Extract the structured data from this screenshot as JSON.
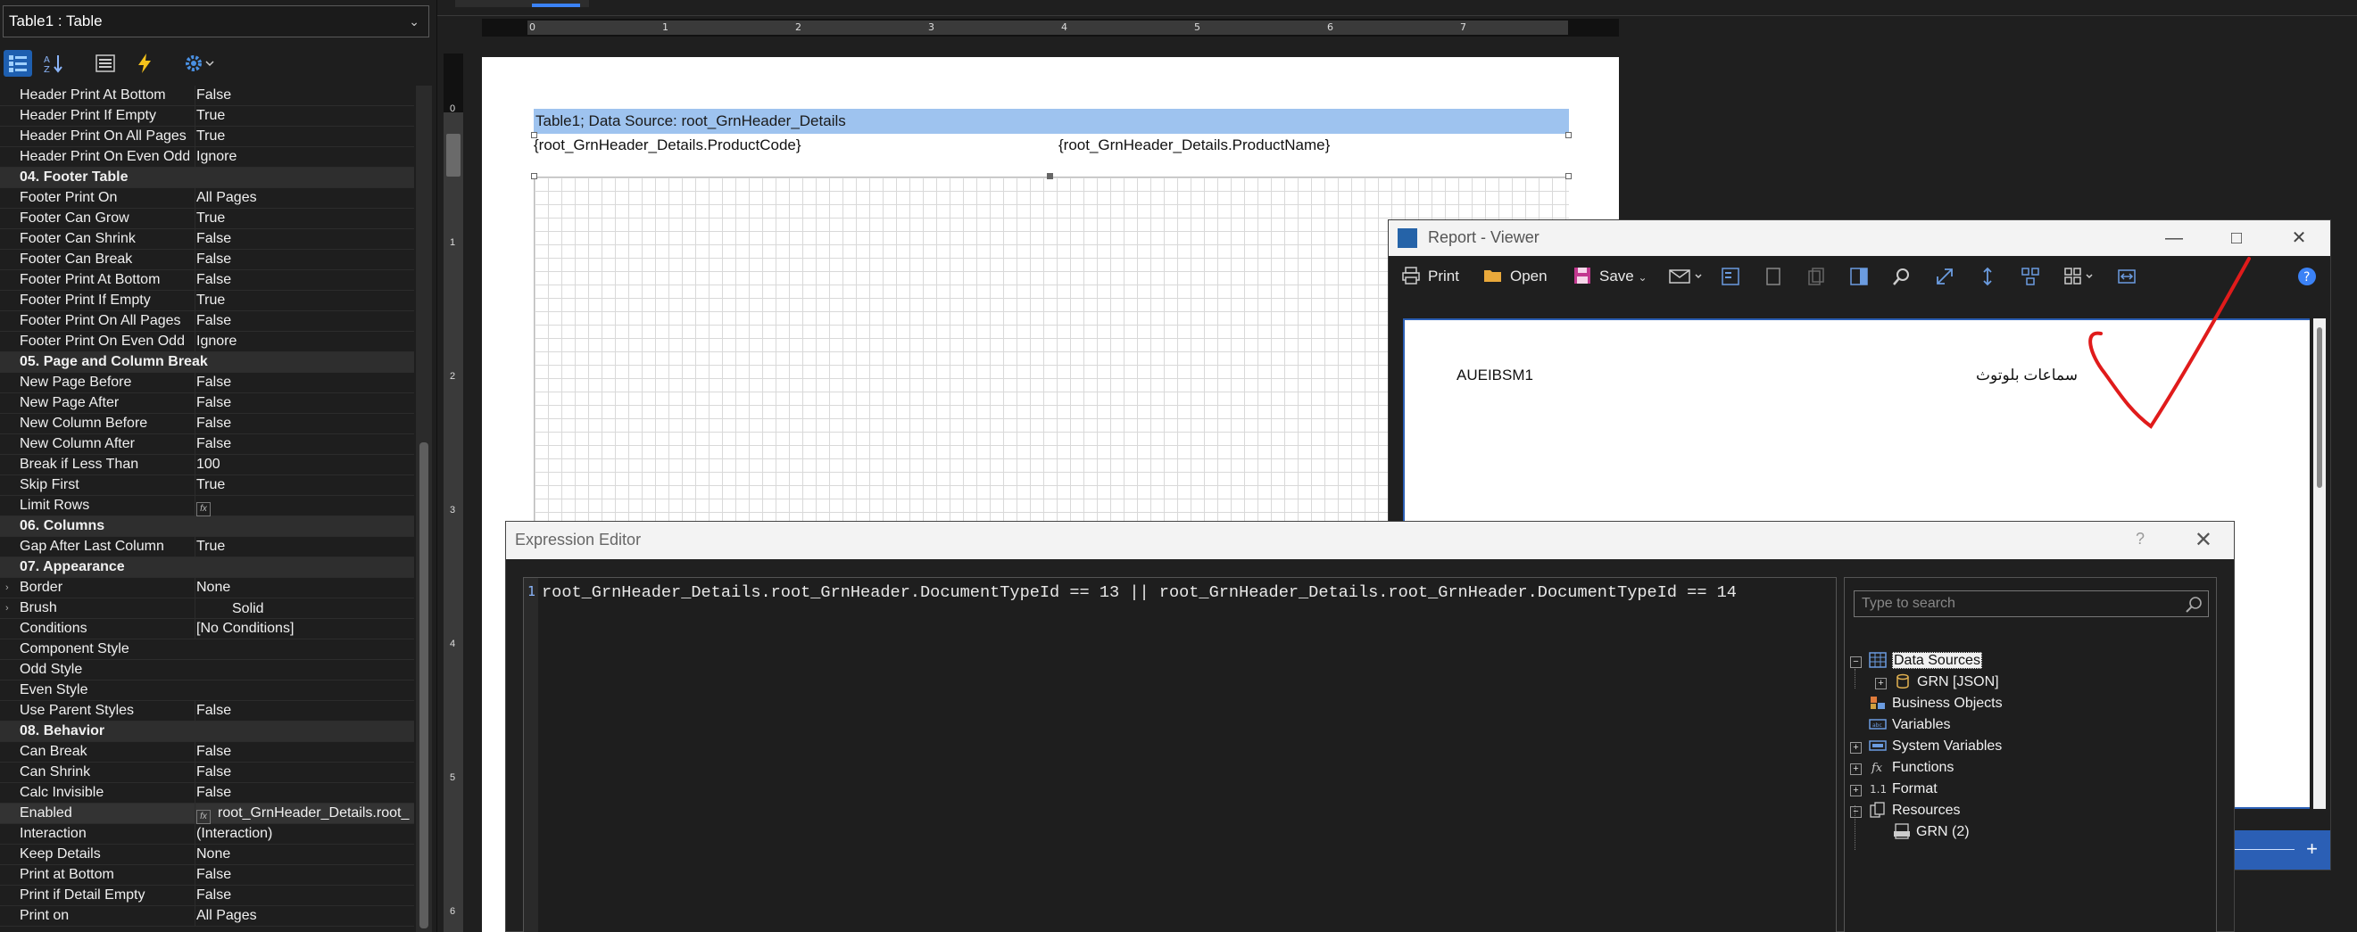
{
  "property_panel": {
    "object_selector": "Table1 : Table",
    "rows": [
      {
        "type": "prop",
        "name": "Header Print At Bottom",
        "value": "False"
      },
      {
        "type": "prop",
        "name": "Header Print If Empty",
        "value": "True"
      },
      {
        "type": "prop",
        "name": "Header Print On All Pages",
        "value": "True"
      },
      {
        "type": "prop",
        "name": "Header Print On Even Odd",
        "value": "Ignore"
      },
      {
        "type": "cat",
        "name": "04. Footer  Table"
      },
      {
        "type": "prop",
        "name": "Footer Print On",
        "value": "All Pages"
      },
      {
        "type": "prop",
        "name": "Footer Can Grow",
        "value": "True"
      },
      {
        "type": "prop",
        "name": "Footer Can Shrink",
        "value": "False"
      },
      {
        "type": "prop",
        "name": "Footer Can Break",
        "value": "False"
      },
      {
        "type": "prop",
        "name": "Footer Print At Bottom",
        "value": "False"
      },
      {
        "type": "prop",
        "name": "Footer Print If Empty",
        "value": "True"
      },
      {
        "type": "prop",
        "name": "Footer Print On All Pages",
        "value": "False"
      },
      {
        "type": "prop",
        "name": "Footer Print On Even Odd P",
        "value": "Ignore"
      },
      {
        "type": "cat",
        "name": "05. Page and  Column  Break"
      },
      {
        "type": "prop",
        "name": "New Page Before",
        "value": "False"
      },
      {
        "type": "prop",
        "name": "New Page After",
        "value": "False"
      },
      {
        "type": "prop",
        "name": "New Column Before",
        "value": "False"
      },
      {
        "type": "prop",
        "name": "New Column After",
        "value": "False"
      },
      {
        "type": "prop",
        "name": "Break if Less Than",
        "value": "100"
      },
      {
        "type": "prop",
        "name": "Skip First",
        "value": "True"
      },
      {
        "type": "fx",
        "name": "Limit Rows",
        "value": ""
      },
      {
        "type": "cat",
        "name": "06. Columns"
      },
      {
        "type": "prop",
        "name": "Gap After Last Column",
        "value": "True"
      },
      {
        "type": "cat",
        "name": "07. Appearance"
      },
      {
        "type": "prop",
        "name": "Border",
        "value": "None",
        "expandable": true
      },
      {
        "type": "brush",
        "name": "Brush",
        "value": "Solid",
        "expandable": true
      },
      {
        "type": "prop",
        "name": "Conditions",
        "value": "[No Conditions]"
      },
      {
        "type": "prop",
        "name": "Component Style",
        "value": ""
      },
      {
        "type": "prop",
        "name": "Odd Style",
        "value": ""
      },
      {
        "type": "prop",
        "name": "Even Style",
        "value": ""
      },
      {
        "type": "prop",
        "name": "Use Parent Styles",
        "value": "False"
      },
      {
        "type": "cat",
        "name": "08. Behavior"
      },
      {
        "type": "prop",
        "name": "Can Break",
        "value": "False"
      },
      {
        "type": "prop",
        "name": "Can Shrink",
        "value": "False"
      },
      {
        "type": "prop",
        "name": "Calc Invisible",
        "value": "False"
      },
      {
        "type": "fx",
        "name": "Enabled",
        "value": "root_GrnHeader_Details.root_",
        "selected": true
      },
      {
        "type": "prop",
        "name": "Interaction",
        "value": "(Interaction)"
      },
      {
        "type": "prop",
        "name": "Keep Details",
        "value": "None"
      },
      {
        "type": "prop",
        "name": "Print at Bottom",
        "value": "False"
      },
      {
        "type": "prop",
        "name": "Print if Detail Empty",
        "value": "False"
      },
      {
        "type": "prop",
        "name": "Print on",
        "value": "All Pages"
      }
    ]
  },
  "designer": {
    "ruler_h": [
      "0",
      "1",
      "2",
      "3",
      "4",
      "5",
      "6",
      "7"
    ],
    "ruler_v": [
      "0",
      "1",
      "2",
      "3",
      "4",
      "5",
      "6"
    ],
    "header_band": "Table1; Data Source: root_GrnHeader_Details",
    "cell_product_code": "{root_GrnHeader_Details.ProductCode}",
    "cell_product_name": "{root_GrnHeader_Details.ProductName}"
  },
  "viewer": {
    "title": "Report - Viewer",
    "toolbar": {
      "print": "Print",
      "open": "Open",
      "save": "Save"
    },
    "preview_code": "AUEIBSM1",
    "preview_name": "سماعات بلوتوث"
  },
  "expression_editor": {
    "title": "Expression Editor",
    "help": "?",
    "line_number": "1",
    "expression": "root_GrnHeader_Details.root_GrnHeader.DocumentTypeId == 13 || root_GrnHeader_Details.root_GrnHeader.DocumentTypeId == 14",
    "search_placeholder": "Type to search",
    "tree": {
      "data_sources": "Data Sources",
      "grn_json": "GRN [JSON]",
      "business_objects": "Business Objects",
      "variables": "Variables",
      "system_variables": "System Variables",
      "functions": "Functions",
      "format": "Format",
      "resources": "Resources",
      "grn_2": "GRN (2)"
    }
  },
  "colors": {
    "accent": "#3b82f6",
    "header_band": "#9ec3ef",
    "check_mark": "#e01b1b",
    "viewer_border": "#2b5fb5"
  }
}
